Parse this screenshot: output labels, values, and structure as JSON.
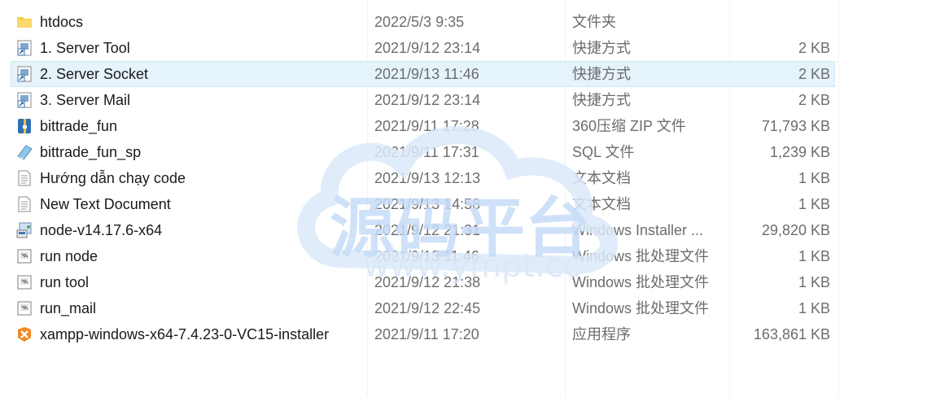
{
  "files": [
    {
      "name": "htdocs",
      "date": "2022/5/3 9:35",
      "type": "文件夹",
      "size": "",
      "icon": "folder-icon",
      "selected": false
    },
    {
      "name": "1. Server Tool",
      "date": "2021/9/12 23:14",
      "type": "快捷方式",
      "size": "2 KB",
      "icon": "shortcut-icon",
      "selected": false
    },
    {
      "name": "2. Server Socket",
      "date": "2021/9/13 11:46",
      "type": "快捷方式",
      "size": "2 KB",
      "icon": "shortcut-icon",
      "selected": true
    },
    {
      "name": "3. Server Mail",
      "date": "2021/9/12 23:14",
      "type": "快捷方式",
      "size": "2 KB",
      "icon": "shortcut-icon",
      "selected": false
    },
    {
      "name": "bittrade_fun",
      "date": "2021/9/11 17:28",
      "type": "360压缩 ZIP 文件",
      "size": "71,793 KB",
      "icon": "zip-archive-icon",
      "selected": false
    },
    {
      "name": "bittrade_fun_sp",
      "date": "2021/9/11 17:31",
      "type": "SQL 文件",
      "size": "1,239 KB",
      "icon": "sql-file-icon",
      "selected": false
    },
    {
      "name": "Hướng dẫn chạy code",
      "date": "2021/9/13 12:13",
      "type": "文本文档",
      "size": "1 KB",
      "icon": "text-document-icon",
      "selected": false
    },
    {
      "name": "New Text Document",
      "date": "2021/9/13 14:58",
      "type": "文本文档",
      "size": "1 KB",
      "icon": "text-document-icon",
      "selected": false
    },
    {
      "name": "node-v14.17.6-x64",
      "date": "2021/9/12 21:31",
      "type": "Windows Installer ...",
      "size": "29,820 KB",
      "icon": "installer-icon",
      "selected": false
    },
    {
      "name": "run node",
      "date": "2021/9/13 11:46",
      "type": "Windows 批处理文件",
      "size": "1 KB",
      "icon": "batch-file-icon",
      "selected": false
    },
    {
      "name": "run tool",
      "date": "2021/9/12 21:38",
      "type": "Windows 批处理文件",
      "size": "1 KB",
      "icon": "batch-file-icon",
      "selected": false
    },
    {
      "name": "run_mail",
      "date": "2021/9/12 22:45",
      "type": "Windows 批处理文件",
      "size": "1 KB",
      "icon": "batch-file-icon",
      "selected": false
    },
    {
      "name": "xampp-windows-x64-7.4.23-0-VC15-installer",
      "date": "2021/9/11 17:20",
      "type": "应用程序",
      "size": "163,861 KB",
      "icon": "application-icon",
      "selected": false
    }
  ],
  "watermark": {
    "text_main": "源码平台",
    "text_url": "www.ympt.cc"
  },
  "colors": {
    "selection": "#e5f3fb",
    "folder": "#f7c948",
    "secondary_text": "#6d6d6d"
  }
}
